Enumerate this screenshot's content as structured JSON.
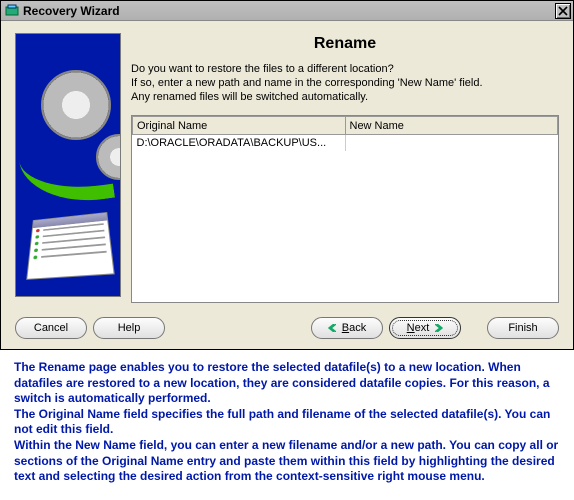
{
  "window": {
    "title": "Recovery Wizard"
  },
  "page": {
    "title": "Rename",
    "prompt_line1": "Do you want to restore the files to a different location?",
    "prompt_line2": "If so, enter a new path and name in the corresponding 'New Name' field.",
    "prompt_line3": "Any renamed files will be switched automatically."
  },
  "table": {
    "columns": {
      "original": "Original Name",
      "newname": "New Name"
    },
    "rows": [
      {
        "original": "D:\\ORACLE\\ORADATA\\BACKUP\\US...",
        "newname": ""
      }
    ]
  },
  "buttons": {
    "cancel": "Cancel",
    "help": "Help",
    "back": "Back",
    "next": "Next",
    "finish": "Finish"
  },
  "caption": {
    "p1": "The Rename page enables you to restore the selected datafile(s) to a new location. When datafiles are restored to a new location, they are considered datafile copies. For this reason, a switch is automatically performed.",
    "p2": "The Original Name field specifies the full path and filename of the selected datafile(s). You can not edit this field.",
    "p3": "Within the New Name field, you can enter a new filename and/or a new path. You can copy all or sections of the Original Name entry and paste them within this field by highlighting the desired text and selecting the desired action from the context-sensitive right mouse menu."
  }
}
